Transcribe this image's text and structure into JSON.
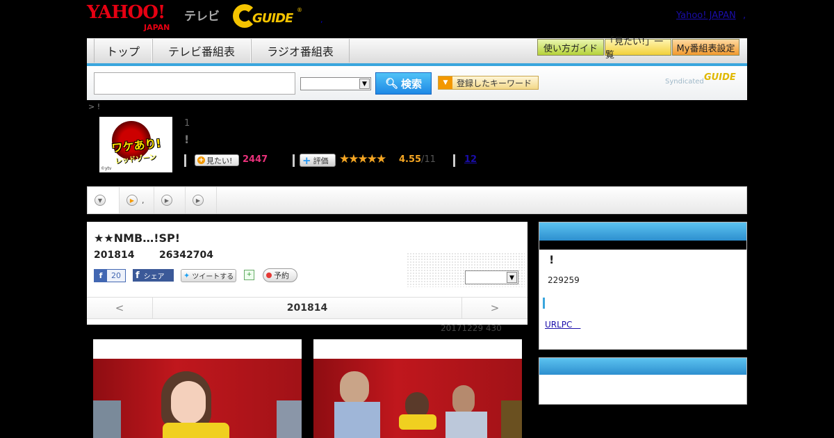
{
  "header": {
    "yahoo_logo": "YAHOO!",
    "yahoo_japan": "JAPAN",
    "tv_word": "テレビ",
    "gguide_logo": "GUIDE",
    "gguide_reg": "®",
    "dot": ",",
    "yahoo_japan_link": "Yahoo! JAPAN",
    "yahoo_link_sep": ","
  },
  "nav": {
    "tabs": [
      "トップ",
      "テレビ番組表",
      "ラジオ番組表"
    ],
    "buttons": [
      "使い方ガイド",
      "「見たい!」一覧",
      "My番組表設定"
    ]
  },
  "search": {
    "input_value": "",
    "select_value": "",
    "search_label": "検索",
    "keyword_label": "登録したキーワード",
    "syndicated": "Syndicated",
    "syn_logo": "GUIDE"
  },
  "breadcrumb": "> !",
  "program": {
    "thumb_title": "ワケあり!",
    "thumb_sub": "レッドゾーン",
    "thumb_credit": "©ytv",
    "number": "1",
    "name": "!",
    "mitai_label": "見たい!",
    "mitai_count": "2447",
    "eval_label": "評価",
    "stars": "★★★★★",
    "rating": 4.55,
    "score": "4.55",
    "score_count": "/11",
    "review_link": "12"
  },
  "tabs": [
    {
      "label": "",
      "icon": "chevron-down-icon"
    },
    {
      "label": ",",
      "icon": "play-icon"
    },
    {
      "label": "",
      "icon": "play-icon"
    },
    {
      "label": "",
      "icon": "play-icon"
    }
  ],
  "episode": {
    "title": "★★NMB…!SP!",
    "date": "201814",
    "viewers": "26342704",
    "fb_like_count": "20",
    "fb_share": "シェア",
    "tweet": "ツイートする",
    "reserve": "予約",
    "select_value": "",
    "pager_prev": "<",
    "pager_date": "201814",
    "pager_next": ">",
    "updated": "20171229  430"
  },
  "sidebar": {
    "box1_title": "!",
    "box1_number": "229259",
    "box1_link": "URLPC　"
  },
  "colors": {
    "accent_blue": "#3aa6dd",
    "pink_count": "#e8317a",
    "star_orange": "#f5a623",
    "yahoo_red": "#e60012",
    "gguide_yellow": "#f5c400"
  }
}
